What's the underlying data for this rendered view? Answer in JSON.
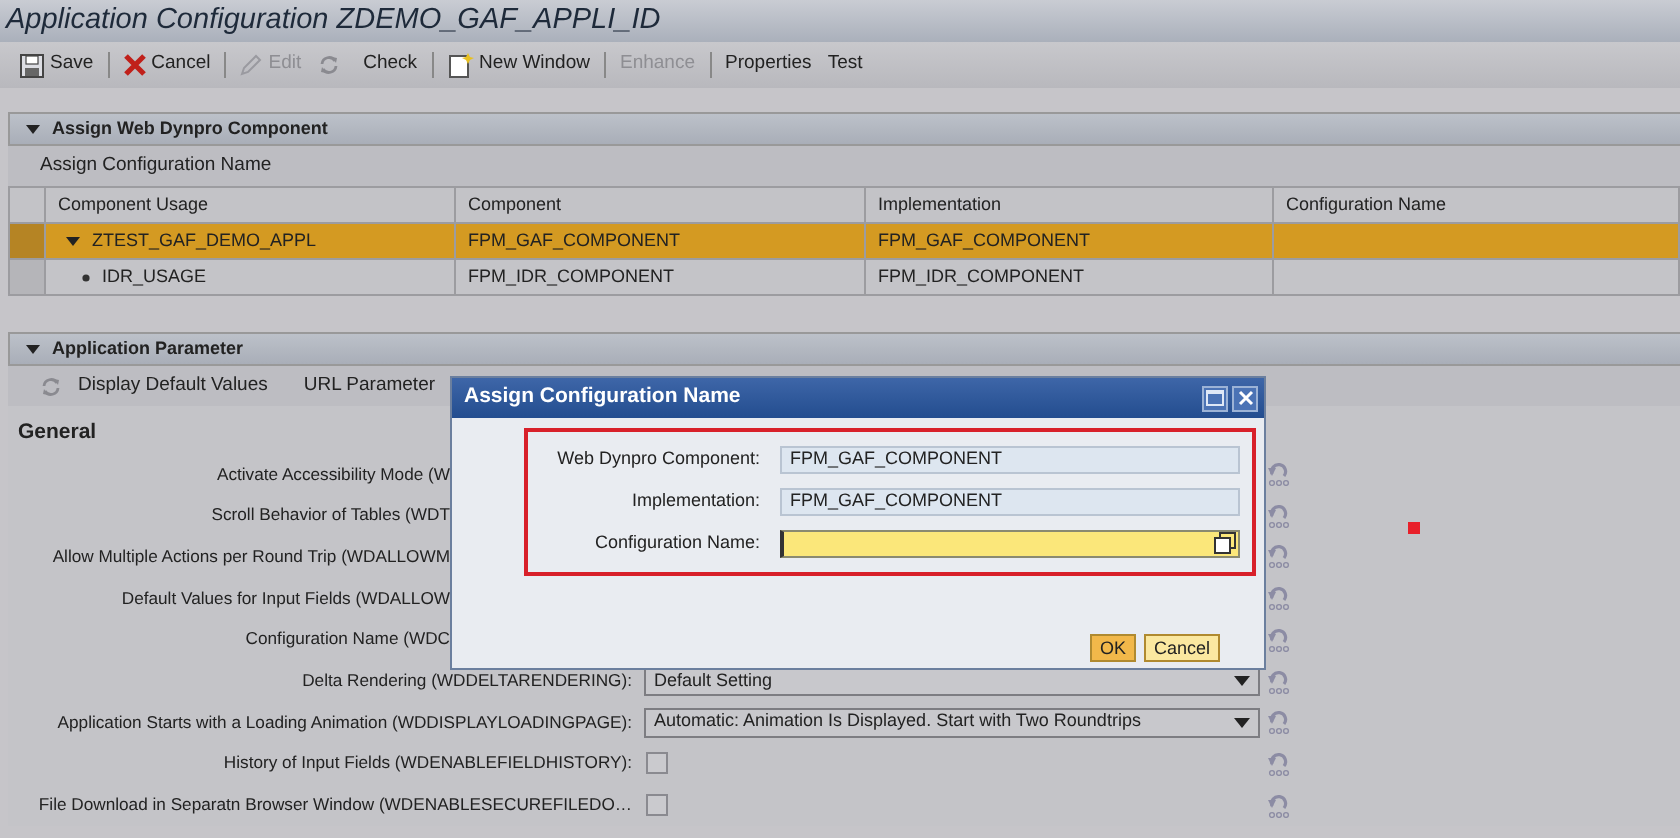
{
  "window": {
    "title": "Application Configuration ZDEMO_GAF_APPLI_ID"
  },
  "toolbar": [
    {
      "label": "Save",
      "disabled": false
    },
    {
      "label": "Cancel",
      "disabled": false
    },
    {
      "label": "Edit",
      "disabled": true
    },
    {
      "label": "Check",
      "disabled": false
    },
    {
      "label": "New Window",
      "disabled": false
    },
    {
      "label": "Enhance",
      "disabled": true
    },
    {
      "label": "Properties",
      "disabled": false
    },
    {
      "label": "Test",
      "disabled": false
    }
  ],
  "component_panel": {
    "title": "Assign Web Dynpro Component",
    "expanded": true,
    "toolbar": [
      "Assign Configuration Name"
    ],
    "table": {
      "columns": [
        "Component Usage",
        "Component",
        "Implementation",
        "Configuration Name"
      ],
      "rows": [
        {
          "usage": "ZTEST_GAF_DEMO_APPL",
          "component": "FPM_GAF_COMPONENT",
          "implementation": "FPM_GAF_COMPONENT",
          "selected": true,
          "expanded": true,
          "children": [
            {
              "usage": "IDR_USAGE",
              "component": "FPM_IDR_COMPONENT",
              "implementation": "FPM_IDR_COMPONENT",
              "selected": false
            }
          ]
        }
      ]
    }
  },
  "parameter_panel": {
    "title": "Application Parameter",
    "expanded": true,
    "toolbar": [
      "Display Default Values",
      "URL Parameter"
    ],
    "section": "General",
    "rows": [
      {
        "kind": "covered",
        "label": "Activate Accessibility Mode (W"
      },
      {
        "kind": "covered",
        "label": "Scroll Behavior of Tables (WDT"
      },
      {
        "kind": "covered",
        "label": "Allow Multiple Actions per Round Trip (WDALLOWM"
      },
      {
        "kind": "covered",
        "label": "Default Values for Input Fields (WDALLOW"
      },
      {
        "kind": "covered",
        "label": "Configuration Name (WDC"
      },
      {
        "kind": "dropdown",
        "label": "Delta Rendering (WDDELTARENDERING):",
        "value": "Default Setting"
      },
      {
        "kind": "dropdown",
        "label": "Application Starts with a Loading Animation (WDDISPLAYLOADINGPAGE):",
        "value": "Automatic: Animation Is Displayed. Start with Two Roundtrips"
      },
      {
        "kind": "checkbox",
        "label": "History of Input Fields (WDENABLEFIELDHISTORY):",
        "checked": false
      },
      {
        "kind": "checkbox",
        "label": "File Download in Separatn Browser Window (WDENABLESECUREFILEDO…",
        "checked": false
      }
    ]
  },
  "dialog": {
    "title": "Assign Configuration Name",
    "fields": [
      {
        "kind": "readonly",
        "label": "Web Dynpro Component:",
        "value": "FPM_GAF_COMPONENT"
      },
      {
        "kind": "readonly",
        "label": "Implementation:",
        "value": "FPM_GAF_COMPONENT"
      },
      {
        "kind": "input",
        "label": "Configuration Name:"
      }
    ],
    "buttons": [
      {
        "label": "OK",
        "emphasized": true
      },
      {
        "label": "Cancel",
        "emphasized": false
      }
    ]
  }
}
